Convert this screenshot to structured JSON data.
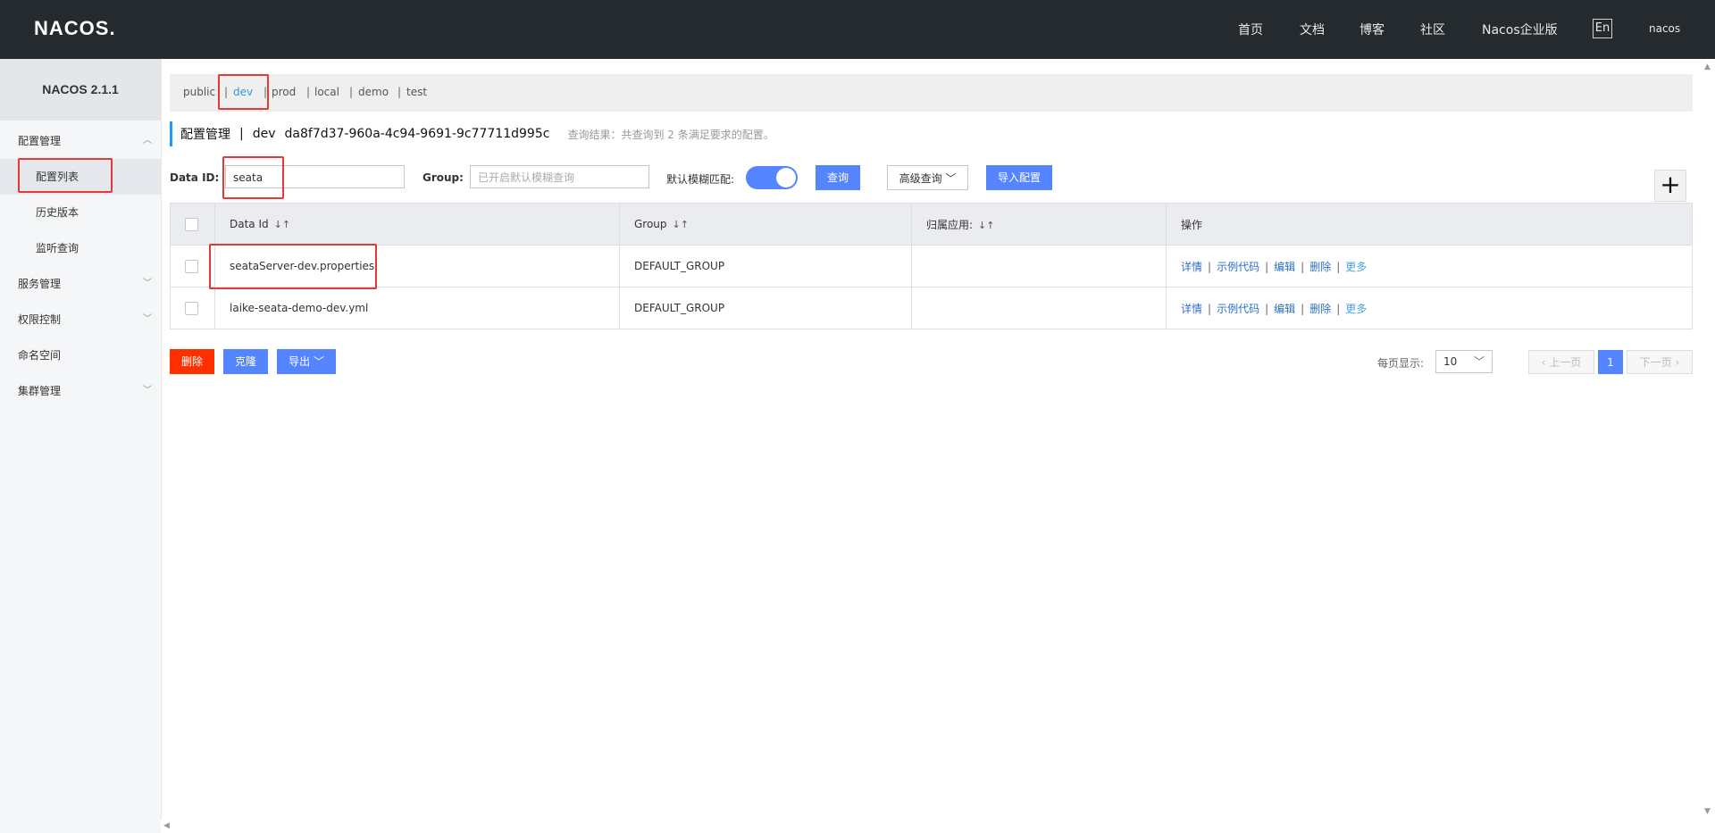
{
  "header": {
    "logo": "NACOS.",
    "nav": [
      "首页",
      "文档",
      "博客",
      "社区",
      "Nacos企业版"
    ],
    "lang": "En",
    "user": "nacos"
  },
  "sidebar": {
    "brand": "NACOS 2.1.1",
    "menu": {
      "config": "配置管理",
      "config_list": "配置列表",
      "history": "历史版本",
      "listener": "监听查询",
      "service": "服务管理",
      "auth": "权限控制",
      "namespace": "命名空间",
      "cluster": "集群管理"
    }
  },
  "namespaces": [
    "public",
    "dev",
    "prod",
    "local",
    "demo",
    "test"
  ],
  "namespace_active": "dev",
  "title": {
    "main": "配置管理",
    "sep": "|",
    "ns": "dev",
    "ns_id": "da8f7d37-960a-4c94-9691-9c77711d995c",
    "result": "查询结果：共查询到 2 条满足要求的配置。"
  },
  "search": {
    "data_id_label": "Data ID:",
    "data_id_value": "seata",
    "group_label": "Group:",
    "group_placeholder": "已开启默认模糊查询",
    "fuzzy_label": "默认模糊匹配:",
    "fuzzy_on": true,
    "query_btn": "查询",
    "advanced_btn": "高级查询",
    "import_btn": "导入配置",
    "add_btn": "+"
  },
  "table": {
    "headers": [
      "Data Id",
      "Group",
      "归属应用:",
      "操作"
    ],
    "rows": [
      {
        "data_id": "seataServer-dev.properties",
        "group": "DEFAULT_GROUP",
        "app": ""
      },
      {
        "data_id": "laike-seata-demo-dev.yml",
        "group": "DEFAULT_GROUP",
        "app": ""
      }
    ],
    "ops": [
      "详情",
      "示例代码",
      "编辑",
      "删除",
      "更多"
    ]
  },
  "bottom": {
    "delete_btn": "删除",
    "clone_btn": "克隆",
    "export_btn": "导出",
    "page_size_label": "每页显示:",
    "page_size": "10",
    "prev": "上一页",
    "current_page": "1",
    "next": "下一页"
  },
  "colors": {
    "header_bg": "#252a2f",
    "primary": "#5584ff",
    "danger": "#ff3000",
    "annotation": "#e53935"
  }
}
